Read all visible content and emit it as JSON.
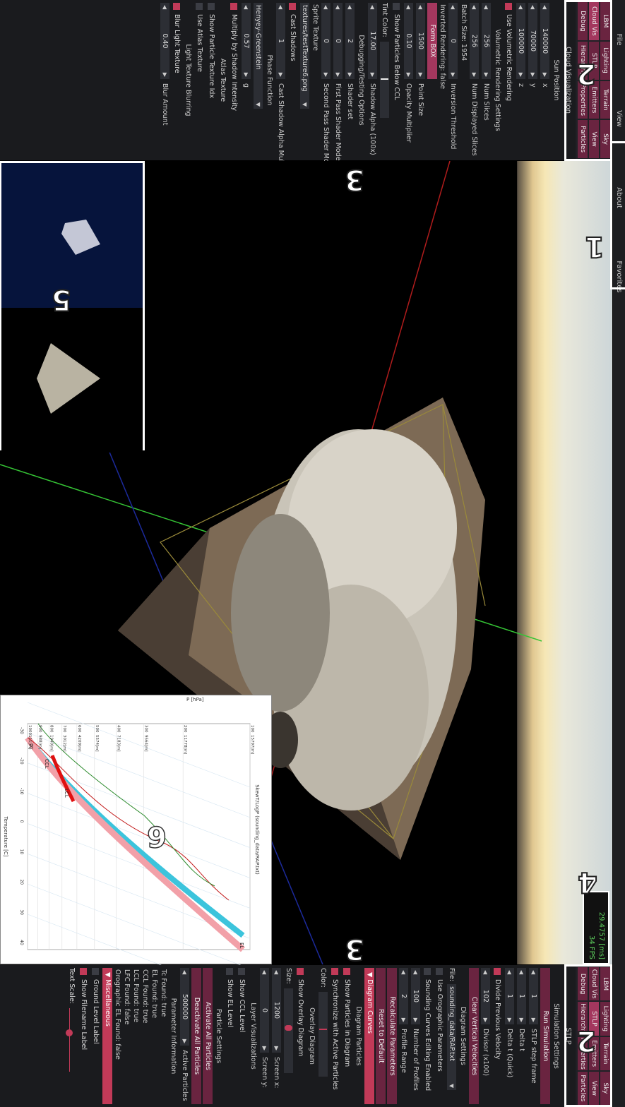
{
  "menu": [
    "File",
    "View",
    "About",
    "Favorites"
  ],
  "overlay_numbers": {
    "menu": "1",
    "tabs_left": "2",
    "tabs_right": "2",
    "viewport_left": "3",
    "viewport_right": "3",
    "fps": "4",
    "inset_views": "5",
    "diagram": "6"
  },
  "fps": {
    "ms": "29.4757 [ms]",
    "fps": "34 FPS"
  },
  "left_panel": {
    "tabs": [
      "LBM",
      "Lighting",
      "Terrain",
      "Sky",
      "Cloud Vis",
      "STLP",
      "Emitters",
      "View",
      "Debug",
      "Hierarchy",
      "Properties",
      "Particles"
    ],
    "title": "Cloud Visualization",
    "sun_position": "Sun Position",
    "sun": [
      {
        "label": "x",
        "value": "140000"
      },
      {
        "label": "y",
        "value": "70000"
      },
      {
        "label": "z",
        "value": "100000"
      }
    ],
    "use_volumetric": "Use Volumetric Rendering",
    "vol_settings": "Volumetric Rendering Settings",
    "num_slices": {
      "label": "Num Slices",
      "value": "256"
    },
    "num_displayed": {
      "label": "Num Displayed Slices",
      "value": "256"
    },
    "batch_size": "Batch Size: 1954",
    "inversion": {
      "label": "Inversion Threshold",
      "value": "0"
    },
    "inverted": "Inverted Rendering: false",
    "form_box": "Form BOX",
    "point_size": {
      "label": "Point Size",
      "value": "1500"
    },
    "opacity": {
      "label": "Opacity Multiplier",
      "value": "0.10"
    },
    "show_below": "Show Particles Below CCL",
    "tint": "Tint Color:",
    "shadow_alpha": {
      "label": "Shadow Alpha (100x)",
      "value": "17.00"
    },
    "debug_title": "Debugging/Testing Options",
    "shader_set": {
      "label": "Shader set",
      "value": "2"
    },
    "first_pass": {
      "label": "First Pass Shader Mode",
      "value": "0"
    },
    "second_pass": {
      "label": "Second Pass Shader Mode",
      "value": "0"
    },
    "sprite_texture": "Sprite Texture",
    "sprite_file": "textures/testTexture6.png",
    "cast_shadows": "Cast Shadows",
    "cast_shadow_alpha": {
      "label": "Cast Shadow Alpha Multiplier",
      "value": "1"
    },
    "phase_function": "Phase Function",
    "phase_value": "Henyey-Greenstein",
    "g": {
      "label": "g",
      "value": "0.57"
    },
    "multiply_shadow": "Multiply by Shadow Intensity",
    "atlas_texture": "Atlas Texture",
    "show_particle_idx": "Show Particle Texture Idx",
    "use_atlas": "Use Atlas Texture",
    "light_blur": "Light Texture Blurring",
    "blur_light": "Blur Light Texture",
    "blur_amount": {
      "label": "Blur Amount",
      "value": "0.40"
    }
  },
  "right_panel": {
    "tabs": [
      "LBM",
      "Lighting",
      "Terrain",
      "Sky",
      "Cloud Vis",
      "STLP",
      "Emitters",
      "View",
      "Debug",
      "Hierarchy",
      "Properties",
      "Particles"
    ],
    "title": "STLP",
    "sim_settings": "Simulation Settings",
    "run_simulation": "Run Simulation",
    "step_frame": {
      "label": "STLP step frame",
      "value": "1"
    },
    "delta_t": {
      "label": "Delta t",
      "value": "1"
    },
    "delta_t_quick": {
      "label": "Delta t (Quick)",
      "value": "1"
    },
    "divide_prev": "Divide Previous Velocity",
    "divisor": {
      "label": "Divisor (x100)",
      "value": "102"
    },
    "clear_vertical": "Clear Vertical Velocities",
    "diagram_settings": "Diagram Settings",
    "file_label": "File:",
    "file_value": "sounding_data/RAP.txt",
    "use_orographic": "Use Orographic Parameters",
    "sounding_editing": "Sounding Curves Editing Enabled",
    "num_profiles": {
      "label": "Number of Profiles",
      "value": "100"
    },
    "profile_range": {
      "label": "Profile Range",
      "value": "2"
    },
    "recalculate": "Recalculate Parameters",
    "reset_default": "Reset to Default",
    "diagram_curves": "Diagram Curves",
    "diagram_particles": "Diagram Particles",
    "show_particles": "Show Particles in Diagram",
    "sync_active": "Synchronize with Active Particles",
    "color": "Color:",
    "overlay_diagram": "Overlay Diagram",
    "show_overlay": "Show Overlay Diagram",
    "size": "Size:",
    "screen_x": {
      "label": "Screen x:",
      "value": "1200"
    },
    "screen_y": {
      "label": "Screen y:",
      "value": "0"
    },
    "layer_vis": "Layer Visualizations",
    "show_ccl": "Show CCL Level",
    "show_el": "Show EL Level",
    "particle_settings": "Particle Settings",
    "activate_all": "Activate All Particles",
    "deactivate_all": "Deactivate All Particles",
    "active_particles": {
      "label": "Active Particles",
      "value": "500000"
    },
    "param_info": "Parameter Information",
    "tc_found": "Tc Found: true",
    "el_found": "EL Found: true",
    "ccl_found": "CCL Found: true",
    "lcl_found": "LCL Found: true",
    "lfc_found": "LFC Found: false",
    "oro_el_found": "Orographic EL Found: false",
    "misc": "Miscellaneous",
    "ground_label": "Ground Level Label",
    "show_filename": "Show Filename Label",
    "text_scale": "Text Scale:"
  },
  "diagram": {
    "title": "SkewT/LogP (sounding_data/RAP.txt)",
    "ylabel": "P [hPa]",
    "xlabel": "Temperature [C]",
    "pressures": [
      {
        "p": "100",
        "h": "15797[m]"
      },
      {
        "p": "200",
        "h": "11778[m]"
      },
      {
        "p": "300",
        "h": "9564[m]"
      },
      {
        "p": "400",
        "h": "7183[m]"
      },
      {
        "p": "500",
        "h": "5574[m]"
      },
      {
        "p": "600",
        "h": "4209[m]"
      },
      {
        "p": "700",
        "h": "3012[m]"
      },
      {
        "p": "800",
        "h": "1940[m]"
      },
      {
        "p": "900",
        "h": "988[m]"
      },
      {
        "p": "1000",
        "h": "111[m]"
      }
    ],
    "temps": [
      "-30",
      "-20",
      "-10",
      "0",
      "10",
      "20",
      "30",
      "40"
    ],
    "labels": {
      "el": "EL",
      "lcl": "LCL",
      "ccl": "CCL",
      "tc": "TC"
    }
  },
  "colors": {
    "accent": "#c23a58",
    "tab": "#6a2440",
    "panel": "#1a1b1e",
    "fps": "#5fd35f",
    "dry_adiabat": "#f2a0a8",
    "moist_adiabat": "#3cc4dc"
  }
}
